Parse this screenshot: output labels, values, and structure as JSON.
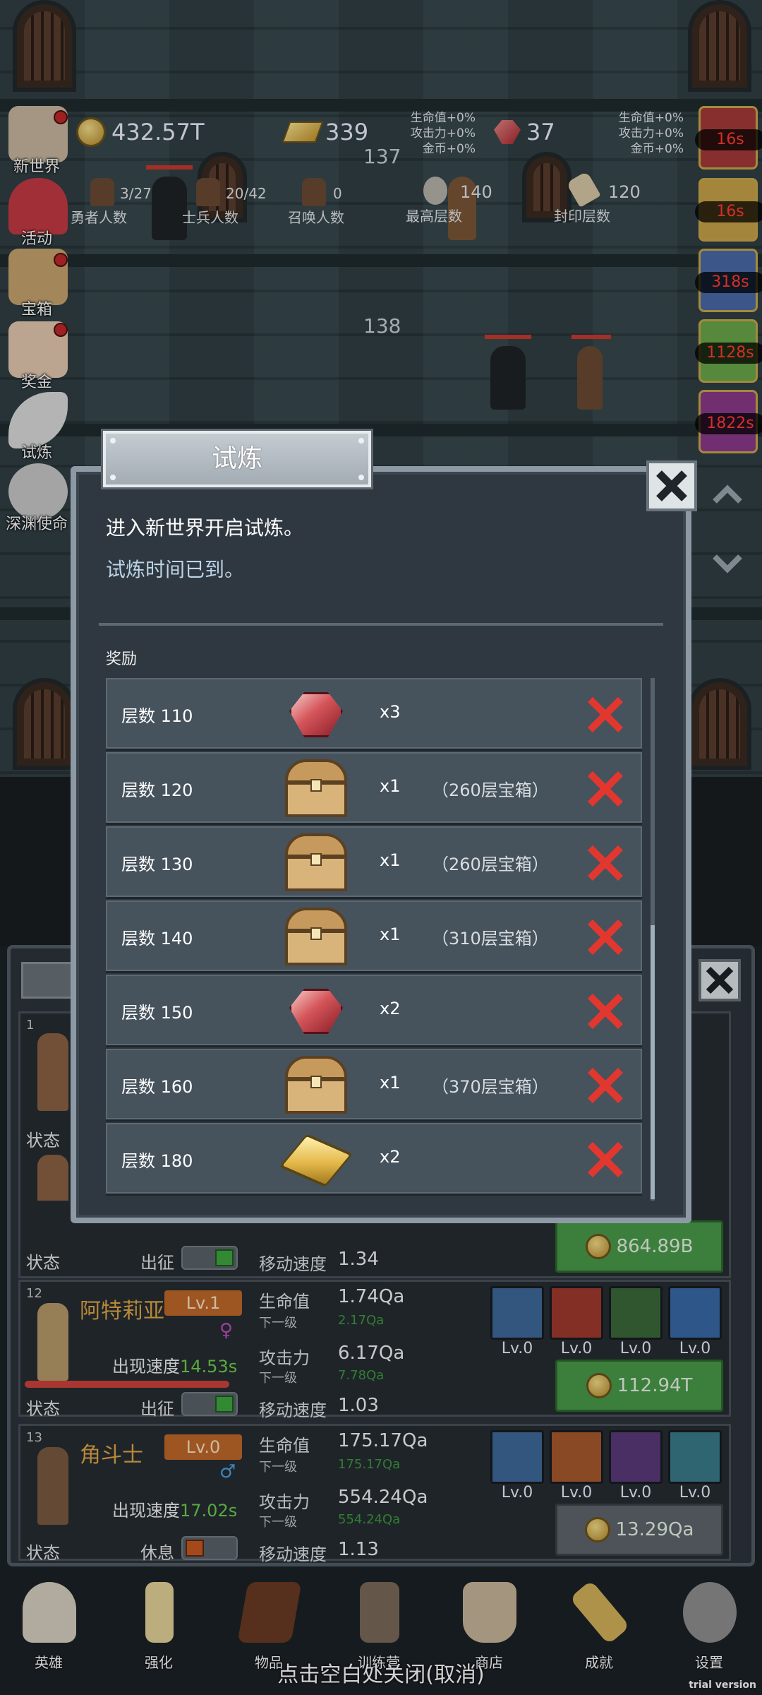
{
  "resources": {
    "coins": "432.57T",
    "gold_bars": "339",
    "gems": "37"
  },
  "buffs": {
    "left": [
      "生命值+0%",
      "攻击力+0%",
      "金币+0%"
    ],
    "right": [
      "生命值+0%",
      "攻击力+0%",
      "金币+0%"
    ]
  },
  "counts": {
    "heroes": {
      "label": "勇者人数",
      "value": "3/27"
    },
    "soldiers": {
      "label": "士兵人数",
      "value": "20/42"
    },
    "summons": {
      "label": "召唤人数",
      "value": "0"
    },
    "max_floor": {
      "label": "最高层数",
      "value": "140"
    },
    "sealed_floor": {
      "label": "封印层数",
      "value": "120"
    }
  },
  "floors": [
    "137",
    "138"
  ],
  "side_menu": [
    "新世界",
    "活动",
    "宝箱",
    "奖金",
    "试炼",
    "深渊使命"
  ],
  "timers": [
    "16s",
    "16s",
    "318s",
    "1128s",
    "1822s"
  ],
  "dialog": {
    "title": "试炼",
    "line1": "进入新世界开启试炼。",
    "line2": "试炼时间已到。",
    "reward_title": "奖励",
    "rows": [
      {
        "label": "层数 110",
        "item": "gem",
        "qty": "x3",
        "note": ""
      },
      {
        "label": "层数 120",
        "item": "chest",
        "qty": "x1",
        "note": "（260层宝箱）"
      },
      {
        "label": "层数 130",
        "item": "chest",
        "qty": "x1",
        "note": "（260层宝箱）"
      },
      {
        "label": "层数 140",
        "item": "chest",
        "qty": "x1",
        "note": "（310层宝箱）"
      },
      {
        "label": "层数 150",
        "item": "gem",
        "qty": "x2",
        "note": ""
      },
      {
        "label": "层数 160",
        "item": "chest",
        "qty": "x1",
        "note": "（370层宝箱）"
      },
      {
        "label": "层数 180",
        "item": "gold-bar",
        "qty": "x2",
        "note": ""
      }
    ]
  },
  "heroes": [
    {
      "index": "",
      "name": "",
      "level": "",
      "speed_label": "",
      "speed": "",
      "status": "状态",
      "mode": "出征",
      "move_label": "移动速度",
      "move": "1.34",
      "price": "864.89B",
      "skills": [],
      "hp_label": "",
      "hp": "",
      "hp_next": "",
      "atk_label": "",
      "atk": "",
      "atk_next": "",
      "next_label": ""
    },
    {
      "index": "12",
      "name": "阿特莉亚",
      "level": "Lv.1",
      "speed_label": "出现速度",
      "speed": "14.53s",
      "status": "状态",
      "mode": "出征",
      "hp_label": "生命值",
      "hp": "1.74Qa",
      "next_label": "下一级",
      "hp_next": "2.17Qa",
      "atk_label": "攻击力",
      "atk": "6.17Qa",
      "atk_next": "7.78Qa",
      "move_label": "移动速度",
      "move": "1.03",
      "price": "112.94T",
      "skills": [
        "Lv.0",
        "Lv.0",
        "Lv.0",
        "Lv.0"
      ]
    },
    {
      "index": "13",
      "name": "角斗士",
      "level": "Lv.0",
      "speed_label": "出现速度",
      "speed": "17.02s",
      "status": "状态",
      "mode": "休息",
      "hp_label": "生命值",
      "hp": "175.17Qa",
      "next_label": "下一级",
      "hp_next": "175.17Qa",
      "atk_label": "攻击力",
      "atk": "554.24Qa",
      "atk_next": "554.24Qa",
      "move_label": "移动速度",
      "move": "1.13",
      "price": "13.29Qa",
      "skills": [
        "Lv.0",
        "Lv.0",
        "Lv.0",
        "Lv.0"
      ]
    }
  ],
  "nav": [
    "英雄",
    "强化",
    "物品",
    "训练营",
    "商店",
    "成就",
    "设置"
  ],
  "close_hint": "点击空白处关闭(取消)",
  "watermark": "trial version",
  "colors": {
    "accent_green": "#4a9b4a",
    "timer_red": "#ff3b30",
    "level_orange": "#c06a2a",
    "fail_red": "#e2372f"
  }
}
